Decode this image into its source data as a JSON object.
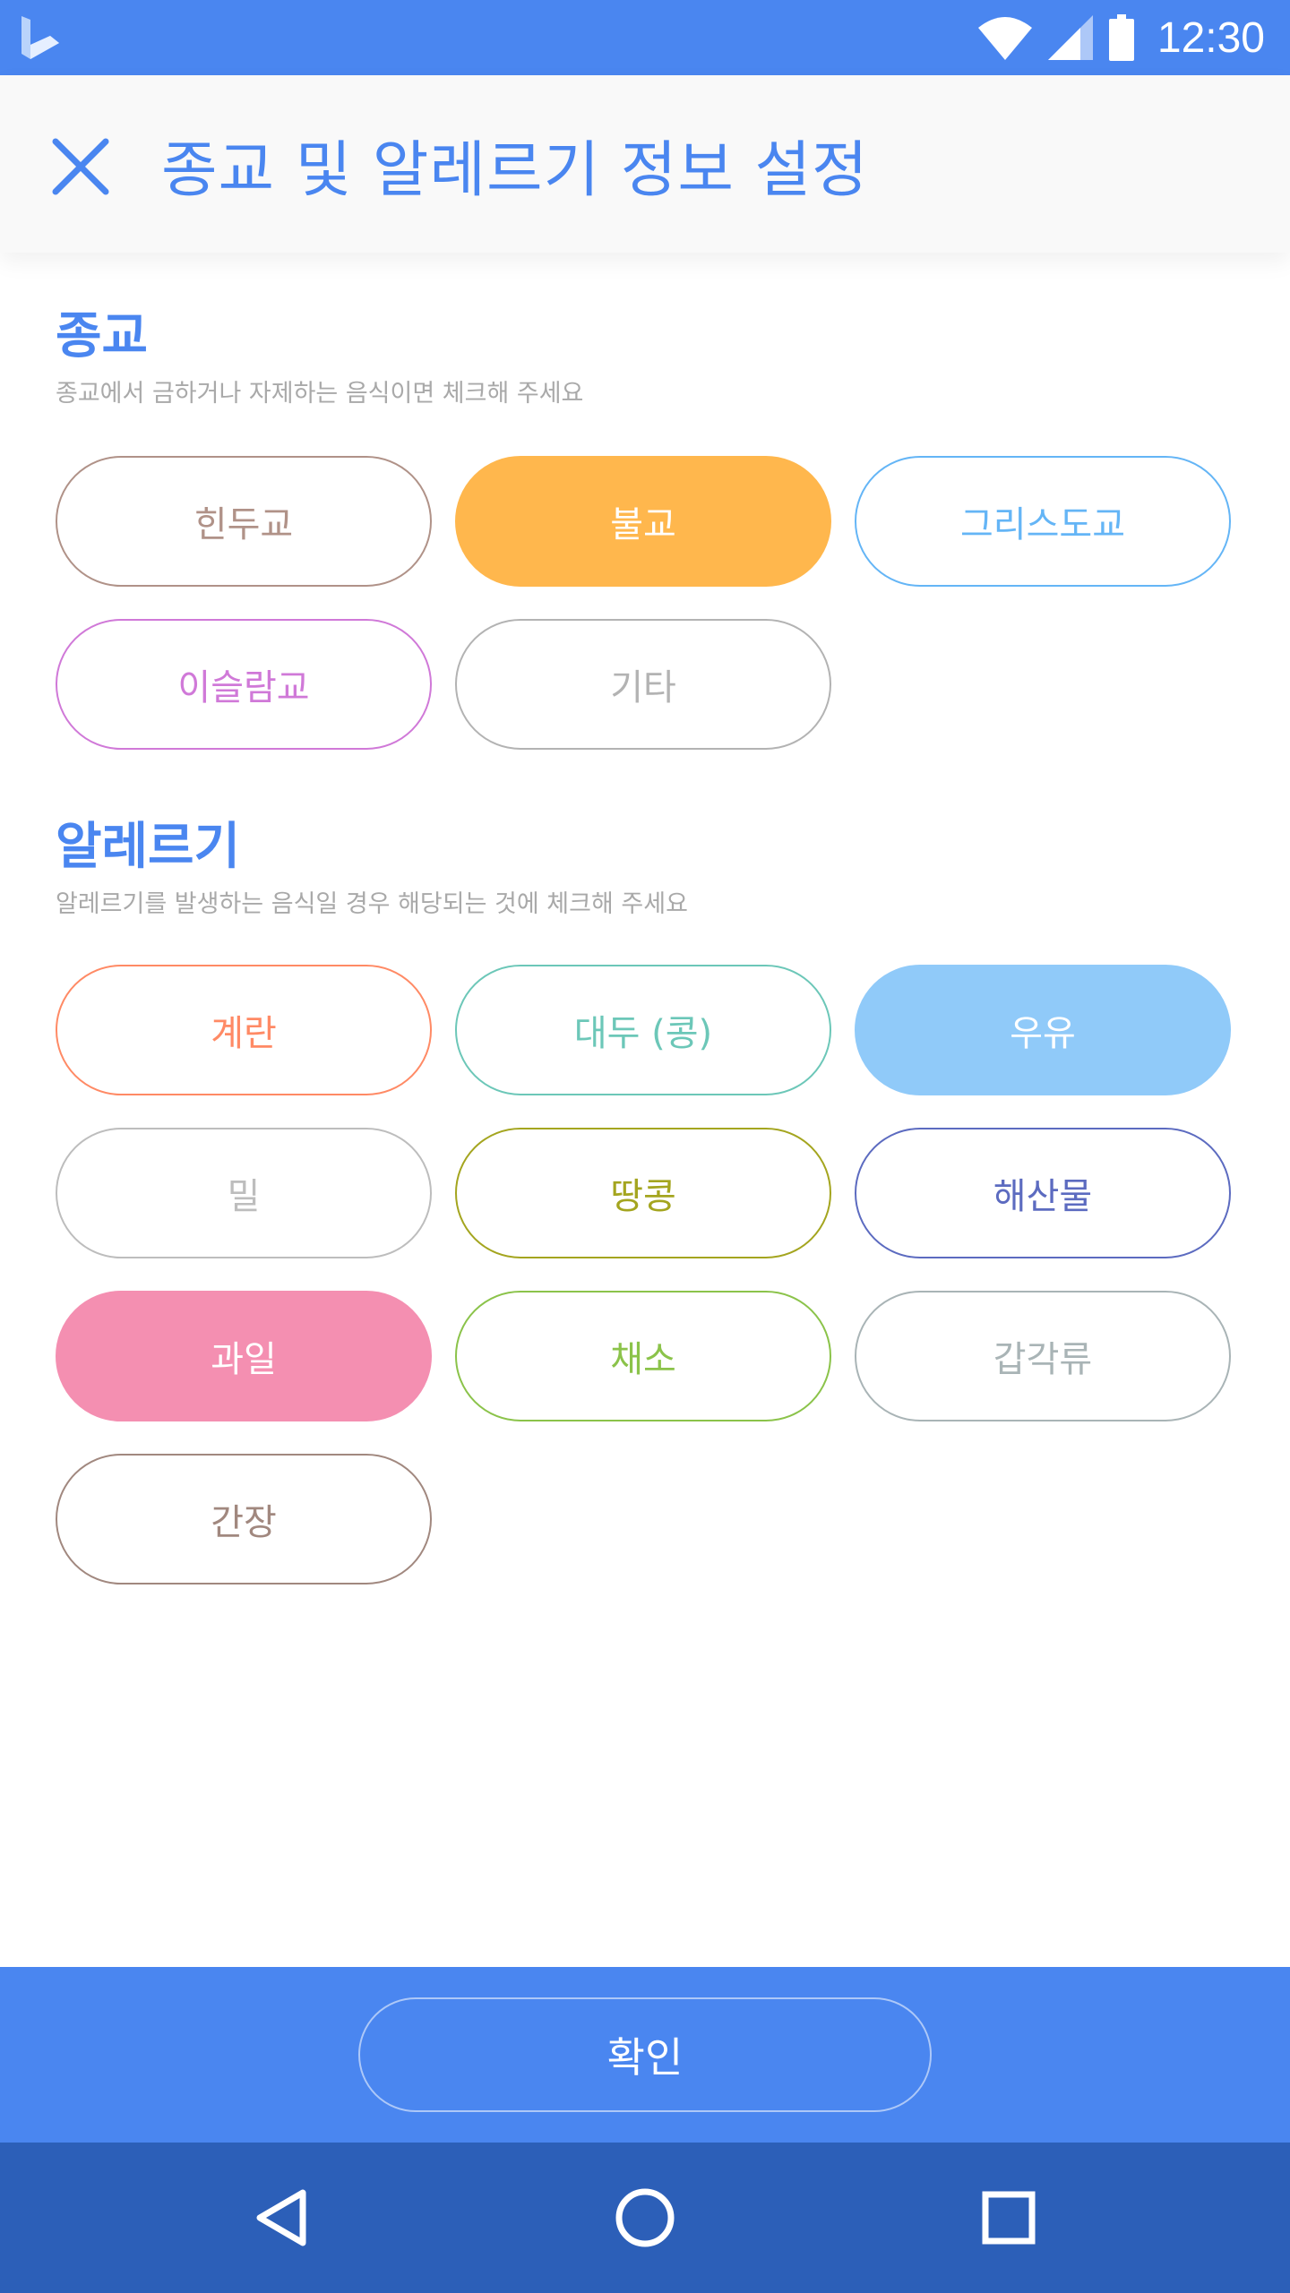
{
  "status_bar": {
    "time": "12:30",
    "icons": [
      "app-logo-icon",
      "wifi-icon",
      "signal-icon",
      "battery-icon"
    ]
  },
  "header": {
    "title": "종교 및 알레르기 정보 설정",
    "close_icon": "close-icon"
  },
  "religion": {
    "title": "종교",
    "description": "종교에서 금하거나 자제하는 음식이면 체크해 주세요",
    "options": [
      {
        "label": "힌두교",
        "color": "#b09288",
        "selected": false
      },
      {
        "label": "불교",
        "color": "#ffb74d",
        "selected": true
      },
      {
        "label": "그리스도교",
        "color": "#64b5f6",
        "selected": false
      },
      {
        "label": "이슬람교",
        "color": "#d079d8",
        "selected": false
      },
      {
        "label": "기타",
        "color": "#b3b3b3",
        "selected": false
      }
    ]
  },
  "allergy": {
    "title": "알레르기",
    "description": "알레르기를 발생하는 음식일 경우 해당되는 것에 체크해 주세요",
    "options": [
      {
        "label": "계란",
        "color": "#ff8a65",
        "selected": false
      },
      {
        "label": "대두 (콩)",
        "color": "#6cc7b8",
        "selected": false
      },
      {
        "label": "우유",
        "color": "#90caf9",
        "selected": true
      },
      {
        "label": "밀",
        "color": "#bdbdbd",
        "selected": false
      },
      {
        "label": "땅콩",
        "color": "#a4a51f",
        "selected": false
      },
      {
        "label": "해산물",
        "color": "#5c6bc0",
        "selected": false
      },
      {
        "label": "과일",
        "color": "#f48fb1",
        "selected": true
      },
      {
        "label": "채소",
        "color": "#8bc34a",
        "selected": false
      },
      {
        "label": "갑각류",
        "color": "#a9b4b6",
        "selected": false
      },
      {
        "label": "간장",
        "color": "#a1887f",
        "selected": false
      }
    ]
  },
  "footer": {
    "confirm_label": "확인"
  },
  "nav": {
    "icons": [
      "back-icon",
      "home-icon",
      "recents-icon"
    ]
  },
  "colors": {
    "primary": "#4a86f0",
    "nav": "#2c5fb8"
  }
}
